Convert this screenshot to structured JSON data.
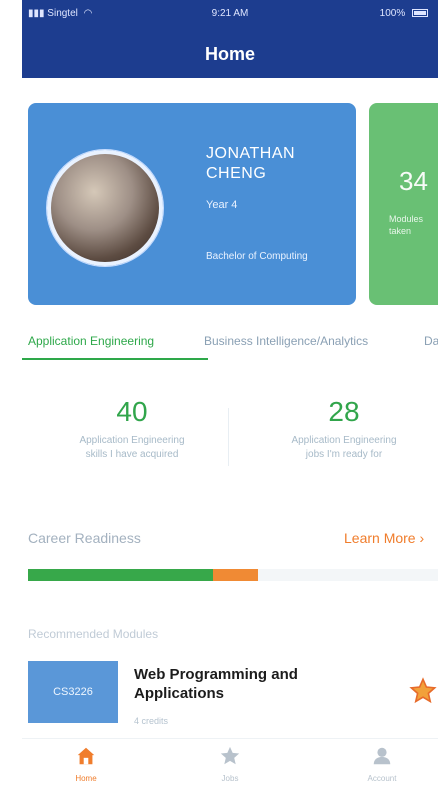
{
  "status_bar": {
    "carrier": "Singtel",
    "time": "9:21 AM",
    "battery": "100%"
  },
  "header": {
    "title": "Home"
  },
  "profile": {
    "name": "JONATHAN CHENG",
    "year": "Year 4",
    "degree": "Bachelor of Computing"
  },
  "green_card": {
    "number": "34",
    "subtitle": "Modules taken"
  },
  "tabs": [
    {
      "label": "Application Engineering",
      "active": true
    },
    {
      "label": "Business Intelligence/Analytics",
      "active": false
    },
    {
      "label": "Da",
      "active": false
    }
  ],
  "stats": [
    {
      "value": "40",
      "label_line1": "Application Engineering",
      "label_line2": "skills I have acquired"
    },
    {
      "value": "28",
      "label_line1": "Application Engineering",
      "label_line2": "jobs I'm ready for"
    }
  ],
  "career": {
    "label": "Career Readiness",
    "learn_more": "Learn More ›",
    "progress_green_pct": 45,
    "progress_orange_pct": 11
  },
  "recommended": {
    "label": "Recommended Modules"
  },
  "module": {
    "code": "CS3226",
    "title": "Web Programming and Applications",
    "credits": "4 credits"
  },
  "bottom_nav": [
    {
      "label": "Home",
      "icon": "home-icon",
      "active": true
    },
    {
      "label": "Jobs",
      "icon": "star-icon",
      "active": false
    },
    {
      "label": "Account",
      "icon": "account-icon",
      "active": false
    }
  ],
  "colors": {
    "header": "#1d3d8f",
    "accent_green": "#2ea84a",
    "accent_orange": "#f07d2c",
    "card_blue": "#4a8fd6",
    "card_green": "#69c074"
  }
}
